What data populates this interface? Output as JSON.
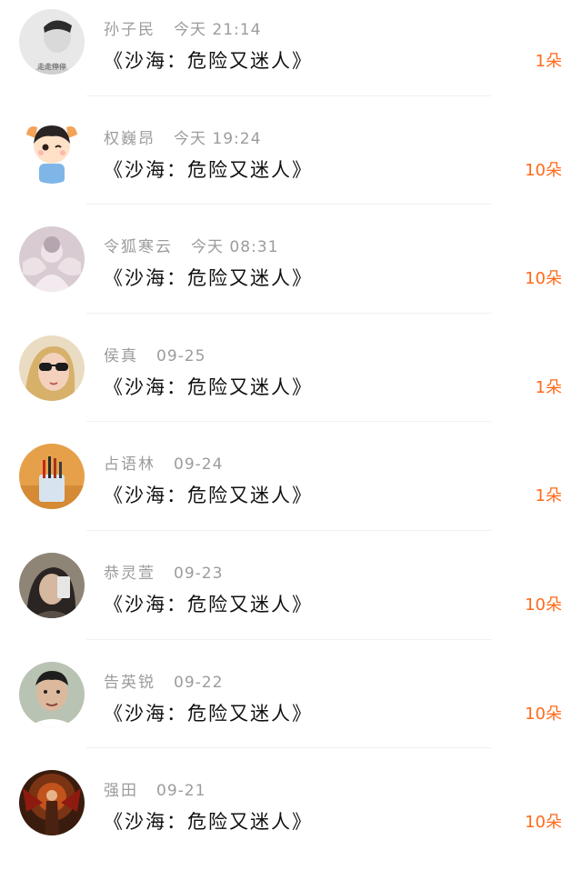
{
  "gift_list": {
    "items": [
      {
        "name": "孙子民",
        "time": "今天 21:14",
        "title": "《沙海：危险又迷人》",
        "gift": "1朵",
        "avatar_caption": "走走停停"
      },
      {
        "name": "权巍昂",
        "time": "今天 19:24",
        "title": "《沙海：危险又迷人》",
        "gift": "10朵"
      },
      {
        "name": "令狐寒云",
        "time": "今天 08:31",
        "title": "《沙海：危险又迷人》",
        "gift": "10朵"
      },
      {
        "name": "侯真",
        "time": "09-25",
        "title": "《沙海：危险又迷人》",
        "gift": "1朵"
      },
      {
        "name": "占语林",
        "time": "09-24",
        "title": "《沙海：危险又迷人》",
        "gift": "1朵"
      },
      {
        "name": "恭灵萱",
        "time": "09-23",
        "title": "《沙海：危险又迷人》",
        "gift": "10朵"
      },
      {
        "name": "告英锐",
        "time": "09-22",
        "title": "《沙海：危险又迷人》",
        "gift": "10朵"
      },
      {
        "name": "强田",
        "time": "09-21",
        "title": "《沙海：危险又迷人》",
        "gift": "10朵"
      }
    ]
  },
  "colors": {
    "gift_accent": "#ff6a1a",
    "meta_gray": "#9c9c9c",
    "title_text": "#111111"
  }
}
